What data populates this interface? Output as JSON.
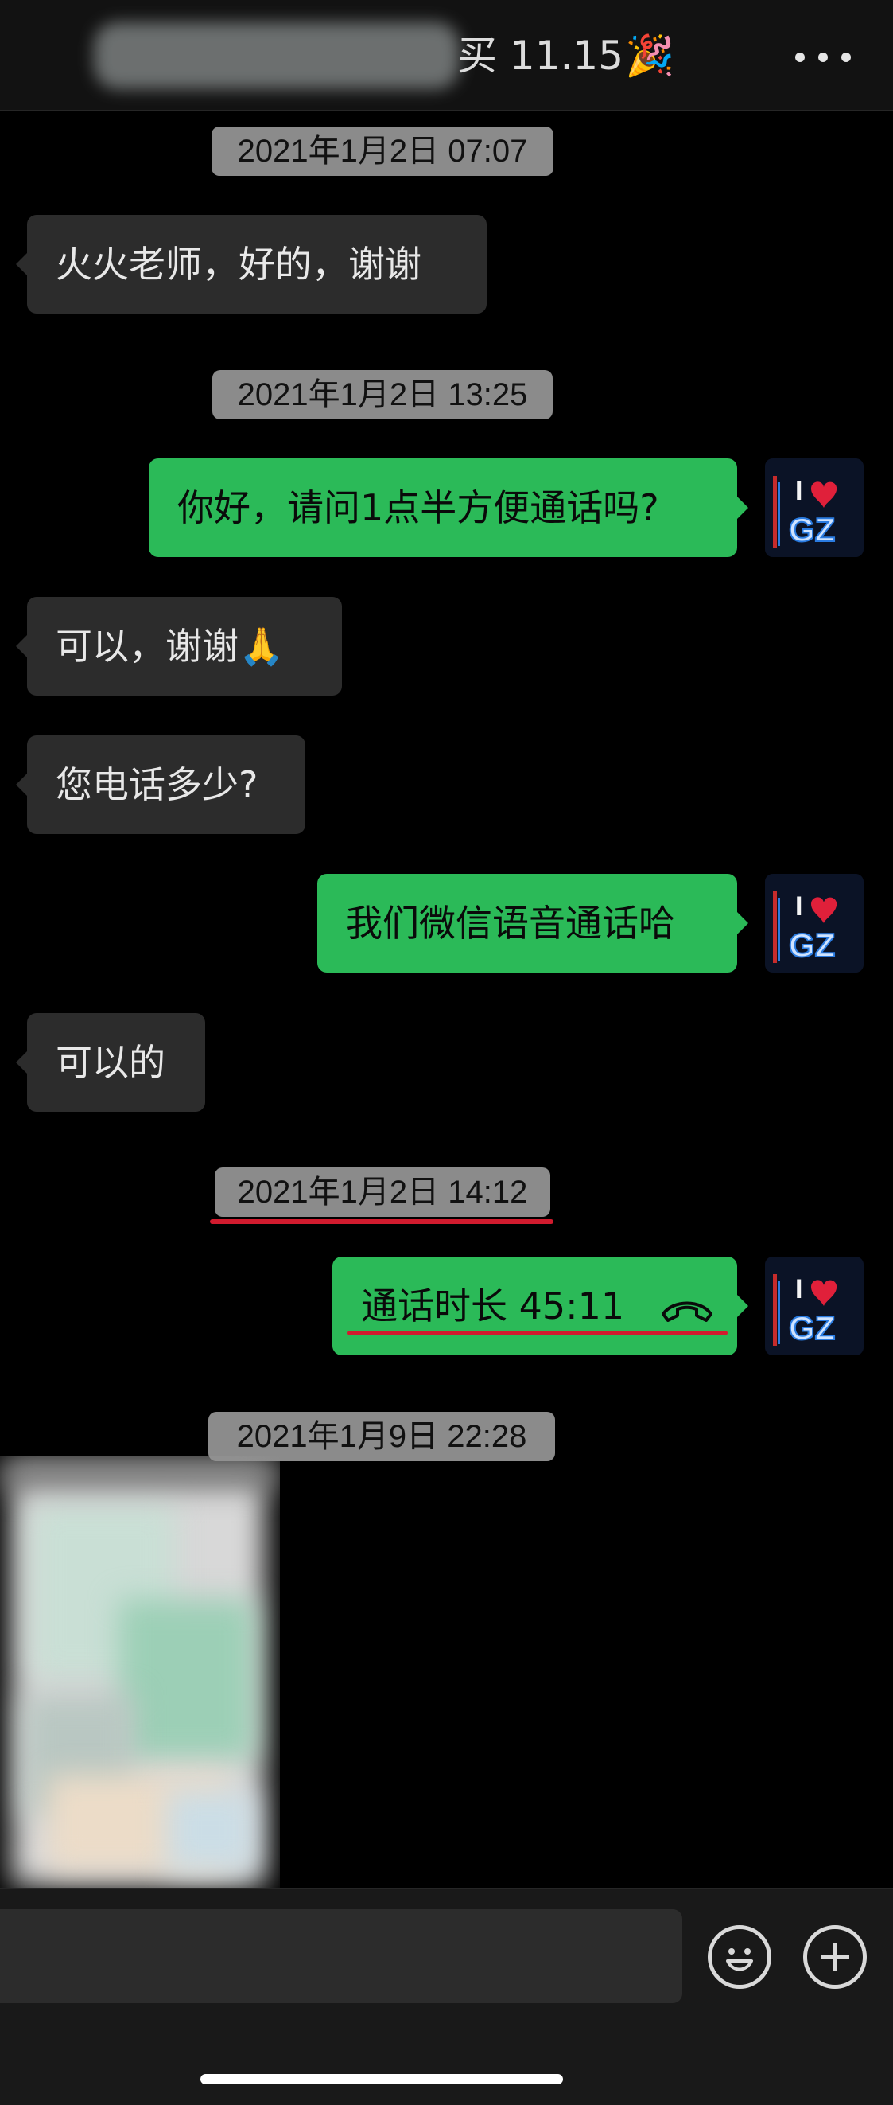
{
  "header": {
    "title_suffix": "买 11.15",
    "title_icon": "🎉",
    "more_icon": "more-dots-icon"
  },
  "messages": [
    {
      "type": "timestamp",
      "text": "2021年1月2日 07:07"
    },
    {
      "type": "incoming",
      "text": "火火老师，好的，谢谢"
    },
    {
      "type": "timestamp",
      "text": "2021年1月2日 13:25"
    },
    {
      "type": "outgoing",
      "text": "你好，请问1点半方便通话吗?"
    },
    {
      "type": "incoming",
      "text": "可以，谢谢",
      "emoji": "🙏"
    },
    {
      "type": "incoming",
      "text": "您电话多少?"
    },
    {
      "type": "outgoing",
      "text": "我们微信语音通话哈"
    },
    {
      "type": "incoming",
      "text": "可以的"
    },
    {
      "type": "timestamp",
      "text": "2021年1月2日 14:12"
    },
    {
      "type": "outgoing-call",
      "text": "通话时长 45:11",
      "icon": "phone-hangup-icon"
    },
    {
      "type": "timestamp",
      "text": "2021年1月9日 22:28"
    },
    {
      "type": "incoming-image",
      "content": "blurred-image"
    }
  ],
  "avatar": {
    "top_letter": "I",
    "bottom_letters": "GZ"
  },
  "input_bar": {
    "emoji_icon": "smiley-face-icon",
    "plus_icon": "plus-circle-icon"
  },
  "colors": {
    "outgoing_bubble": "#2bba58",
    "incoming_bubble": "#2c2c2c",
    "timestamp_bg": "#8b8b8b",
    "annotation_red": "#d11b2e"
  }
}
